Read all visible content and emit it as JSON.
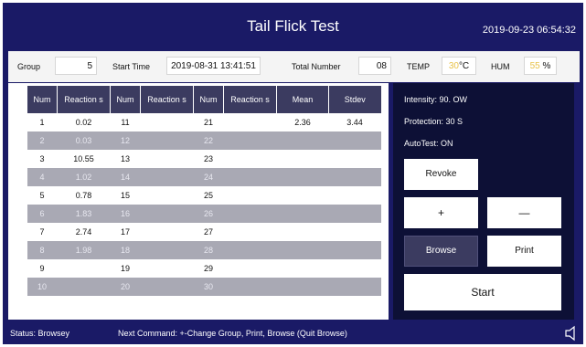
{
  "header": {
    "title": "Tail Flick Test",
    "datetime": "2019-09-23 06:54:32"
  },
  "info": {
    "group_label": "Group",
    "group_value": "5",
    "start_time_label": "Start Time",
    "start_time_value": "2019-08-31 13:41:51",
    "total_number_label": "Total Number",
    "total_number_value": "08",
    "temp_label": "TEMP",
    "temp_value": "30",
    "temp_unit": "°C",
    "hum_label": "HUM",
    "hum_value": "55",
    "hum_unit": "%"
  },
  "table": {
    "headers": [
      "Num",
      "Reaction s",
      "Num",
      "Reaction s",
      "Num",
      "Reaction s",
      "Mean",
      "Stdev"
    ],
    "rows": [
      [
        "1",
        "0.02",
        "11",
        "",
        "21",
        "",
        "2.36",
        "3.44"
      ],
      [
        "2",
        "0.03",
        "12",
        "",
        "22",
        "",
        "",
        ""
      ],
      [
        "3",
        "10.55",
        "13",
        "",
        "23",
        "",
        "",
        ""
      ],
      [
        "4",
        "1.02",
        "14",
        "",
        "24",
        "",
        "",
        ""
      ],
      [
        "5",
        "0.78",
        "15",
        "",
        "25",
        "",
        "",
        ""
      ],
      [
        "6",
        "1.83",
        "16",
        "",
        "26",
        "",
        "",
        ""
      ],
      [
        "7",
        "2.74",
        "17",
        "",
        "27",
        "",
        "",
        ""
      ],
      [
        "8",
        "1.98",
        "18",
        "",
        "28",
        "",
        "",
        ""
      ],
      [
        "9",
        "",
        "19",
        "",
        "29",
        "",
        "",
        ""
      ],
      [
        "10",
        "",
        "20",
        "",
        "30",
        "",
        "",
        ""
      ]
    ]
  },
  "settings": {
    "intensity_label": "Intensity:",
    "intensity_value": "90. OW",
    "protection_label": "Protection:",
    "protection_value": "30 S",
    "autotest_label": "AutoTest:",
    "autotest_value": "ON"
  },
  "buttons": {
    "revoke": "Revoke",
    "plus": "+",
    "minus": "—",
    "browse": "Browse",
    "print": "Print",
    "start": "Start"
  },
  "status": {
    "status_text": "Status:  Browsey",
    "next_command": "Next Command:  +-Change Group, Print, Browse (Quit Browse)"
  },
  "icons": {
    "speaker": "speaker-icon"
  },
  "colors": {
    "frame": "#1a1a66",
    "panel": "#0d1036",
    "table_header": "#3b3b60",
    "accent_yellow": "#e8c24a"
  }
}
